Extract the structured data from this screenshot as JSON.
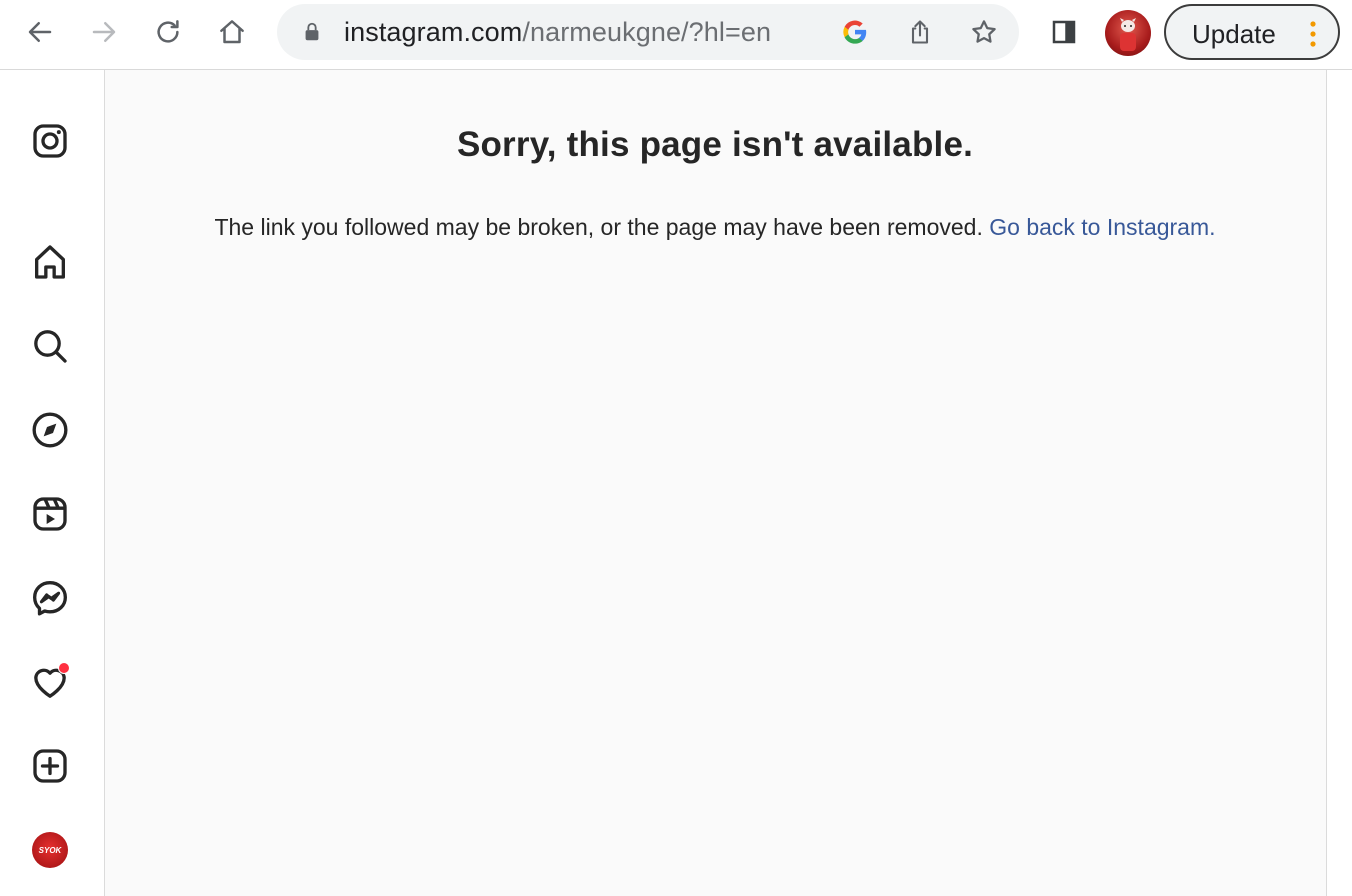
{
  "browser": {
    "url_host": "instagram.com",
    "url_path": "/narmeukgne/?hl=en",
    "update_label": "Update",
    "icons": [
      "back-icon",
      "forward-icon",
      "reload-icon",
      "home-icon",
      "lock-icon",
      "google-lens-icon",
      "share-icon",
      "bookmark-star-icon",
      "side-panel-icon",
      "profile-avatar",
      "more-dots-icon"
    ],
    "update_dots_color": "#f29900"
  },
  "sidebar": {
    "items": [
      {
        "name": "instagram-logo",
        "icon": "instagram-icon"
      },
      {
        "name": "home",
        "icon": "home-icon"
      },
      {
        "name": "search",
        "icon": "search-icon"
      },
      {
        "name": "explore",
        "icon": "compass-icon"
      },
      {
        "name": "reels",
        "icon": "reels-icon"
      },
      {
        "name": "messages",
        "icon": "messenger-icon"
      },
      {
        "name": "notifications",
        "icon": "heart-icon",
        "badge_color": "#ff3040"
      },
      {
        "name": "create",
        "icon": "plus-square-icon"
      },
      {
        "name": "profile",
        "icon": "profile-avatar",
        "avatar_text": "SYOK"
      }
    ]
  },
  "main": {
    "title": "Sorry, this page isn't available.",
    "message": "The link you followed may be broken, or the page may have been removed.",
    "link_text": "Go back to Instagram.",
    "link_color": "#385898"
  }
}
